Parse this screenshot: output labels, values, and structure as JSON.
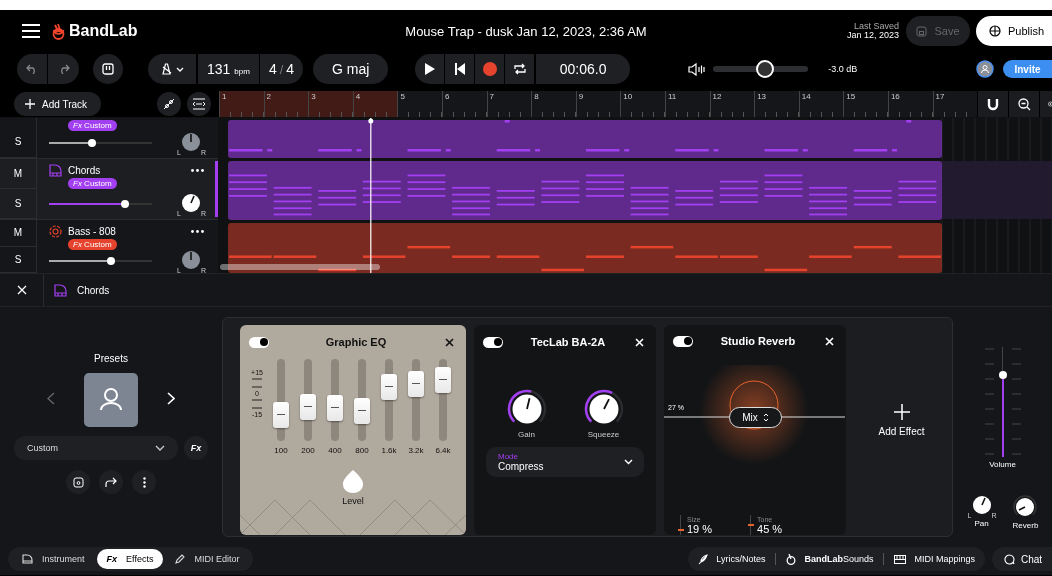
{
  "app": {
    "logo": "BandLab"
  },
  "project_title": "Mouse Trap - dusk Jan 12, 2023, 2:36 AM",
  "last_saved": {
    "label": "Last Saved",
    "date": "Jan 12, 2023"
  },
  "save_button": {
    "label": "Save",
    "disabled": true
  },
  "publish_button": "Publish",
  "transport": {
    "tempo": "131",
    "tempo_unit": "bpm",
    "beats": "4",
    "separator": "/",
    "beat_unit": "4",
    "key": "G maj",
    "time": "00:06.0"
  },
  "master_volume": {
    "level": 0.55,
    "reading": "-3.0 dB"
  },
  "invite_button": "Invite",
  "add_track_button": "Add Track",
  "ruler": [
    {
      "label": "1",
      "in_loop": true,
      "playhead": false
    },
    {
      "label": "2",
      "in_loop": true,
      "playhead": false
    },
    {
      "label": "3",
      "in_loop": true,
      "playhead": false
    },
    {
      "label": "4",
      "in_loop": true,
      "playhead": true
    },
    {
      "label": "5",
      "in_loop": false,
      "playhead": false
    },
    {
      "label": "6",
      "in_loop": false,
      "playhead": false
    },
    {
      "label": "7",
      "in_loop": false,
      "playhead": false
    },
    {
      "label": "8",
      "in_loop": false,
      "playhead": false
    },
    {
      "label": "9",
      "in_loop": false,
      "playhead": false
    },
    {
      "label": "10",
      "in_loop": false,
      "playhead": false
    },
    {
      "label": "11",
      "in_loop": false,
      "playhead": false
    },
    {
      "label": "12",
      "in_loop": false,
      "playhead": false
    },
    {
      "label": "13",
      "in_loop": false,
      "playhead": false
    },
    {
      "label": "14",
      "in_loop": false,
      "playhead": false
    },
    {
      "label": "15",
      "in_loop": false,
      "playhead": false
    },
    {
      "label": "16",
      "in_loop": false,
      "playhead": false
    },
    {
      "label": "17",
      "in_loop": false,
      "playhead": false
    }
  ],
  "tracks": [
    {
      "kind": "melody",
      "badge": "*Fx* Custom",
      "solo_label": "S",
      "color": "#a23ff0",
      "selected": false,
      "volume": {
        "level": 0.42
      },
      "pan_labels": [
        "L",
        "R"
      ]
    },
    {
      "kind": "chords",
      "name": "Chords",
      "badge": "*Fx* Custom",
      "mute_label": "M",
      "solo_label": "S",
      "color": "#a23ff0",
      "selected": true,
      "volume": {
        "level": 0.74
      },
      "pan_labels": [
        "L",
        "R"
      ]
    },
    {
      "kind": "bass",
      "name": "Bass - 808",
      "badge": "*Fx* Custom",
      "mute_label": "M",
      "solo_label": "S",
      "color": "#e5432d",
      "selected": false,
      "volume": {
        "level": 0.6
      },
      "pan_labels": [
        "L",
        "R"
      ]
    }
  ],
  "editor": {
    "track_name": "Chords"
  },
  "presets": {
    "title": "Presets",
    "preset": "Custom",
    "fx_label": "Fx"
  },
  "effects": [
    {
      "kind": "graphic_eq",
      "title": "Graphic EQ",
      "on": true,
      "scale": [
        "+15",
        "0",
        "-15"
      ],
      "bands": [
        {
          "label": "100",
          "level": 0.32
        },
        {
          "label": "200",
          "level": 0.42
        },
        {
          "label": "400",
          "level": 0.4
        },
        {
          "label": "800",
          "level": 0.36
        },
        {
          "label": "1.6k",
          "level": 0.66
        },
        {
          "label": "3.2k",
          "level": 0.7
        },
        {
          "label": "6.4k",
          "level": 0.74
        }
      ],
      "level_label": "Level"
    },
    {
      "kind": "compressor",
      "title": "TecLab BA-2A",
      "on": true,
      "knobs": [
        {
          "label": "Gain",
          "level": 0.55
        },
        {
          "label": "Squeeze",
          "level": 0.6
        }
      ],
      "mode": {
        "label": "Mode",
        "value": "Compress"
      }
    },
    {
      "kind": "reverb",
      "title": "Studio Reverb",
      "on": true,
      "mix_reading": "27 %",
      "mix_label": "Mix",
      "params": [
        {
          "label": "Size",
          "value": "19 %",
          "level": 0.19
        },
        {
          "label": "Tone",
          "value": "45 %",
          "level": 0.45
        }
      ]
    }
  ],
  "add_effect": "Add Effect",
  "mixer": {
    "volume": {
      "label": "Volume",
      "level": 0.75
    },
    "pan": {
      "label": "Pan",
      "labels": [
        "L",
        "R"
      ]
    },
    "reverb": {
      "label": "Reverb"
    }
  },
  "bottom_tabs": [
    {
      "kind": "instrument",
      "label": "Instrument",
      "selected": false
    },
    {
      "kind": "effects",
      "icon_text": "Fx",
      "label": "Effects",
      "selected": true
    },
    {
      "kind": "midi",
      "label": "MIDI Editor",
      "selected": false
    }
  ],
  "bottom_links": [
    {
      "kind": "lyrics",
      "label": "Lyrics/Notes"
    },
    {
      "kind": "sounds",
      "brand": "BandLab",
      "label": "Sounds"
    },
    {
      "kind": "mappings",
      "label": "MIDI Mappings"
    }
  ],
  "chat_button": "Chat"
}
